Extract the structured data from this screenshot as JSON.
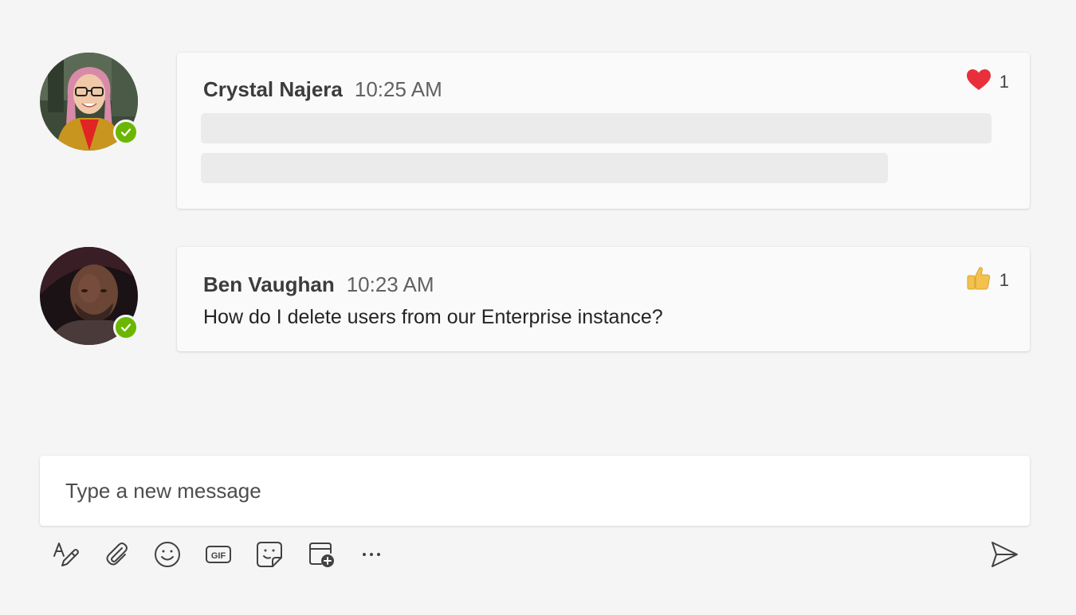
{
  "messages": [
    {
      "author": "Crystal Najera",
      "time": "10:25 AM",
      "reaction": {
        "icon": "heart-icon",
        "count": "1",
        "color": "#e8303a"
      },
      "body": ""
    },
    {
      "author": "Ben Vaughan",
      "time": "10:23 AM",
      "reaction": {
        "icon": "thumbs-up-icon",
        "count": "1",
        "color": "#f2c14e"
      },
      "body": "How do I delete users from our Enterprise instance?"
    }
  ],
  "compose": {
    "placeholder": "Type a new message"
  },
  "toolbar": {
    "items": [
      "format-icon",
      "attach-icon",
      "emoji-icon",
      "gif-icon",
      "sticker-icon",
      "schedule-meeting-icon",
      "more-options-icon"
    ],
    "send": "send-icon"
  },
  "colors": {
    "background": "#f5f5f5",
    "presence_available": "#6bb700",
    "icon": "#424242"
  }
}
